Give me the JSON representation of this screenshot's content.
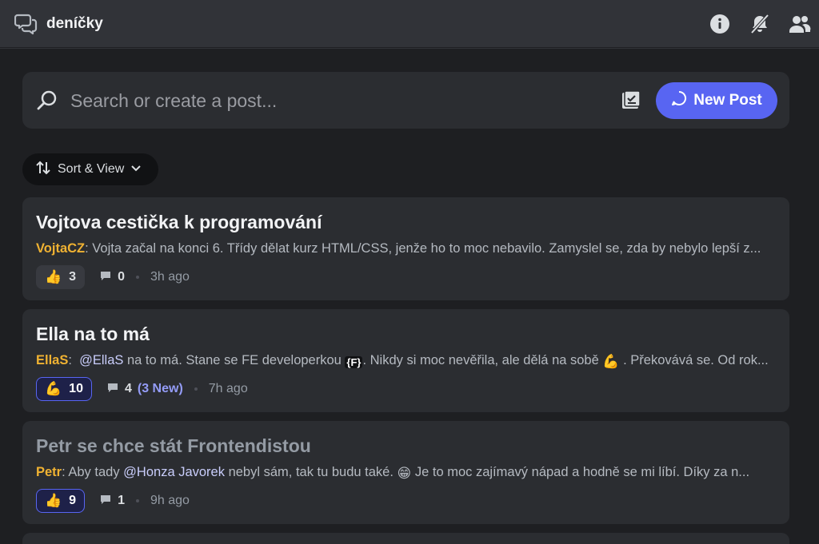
{
  "header": {
    "channel_name": "deníčky",
    "icons": [
      "forum-channel-icon",
      "info-icon",
      "notifications-muted-icon",
      "members-icon"
    ]
  },
  "search": {
    "placeholder": "Search or create a post...",
    "new_post_label": "New Post"
  },
  "sort": {
    "label": "Sort & View"
  },
  "posts": [
    {
      "title": "Vojtova cestička k programování",
      "author": "VojtaCZ",
      "preview": "Vojta začal na konci 6. Třídy dělat kurz HTML/CSS, jenže ho to moc nebavilo. Zamyslel se, zda by nebylo lepší z...",
      "reaction_emoji": "👍",
      "reaction_count": "3",
      "comment_count": "0",
      "new_comments": "",
      "time": "3h ago",
      "read": false
    },
    {
      "title": "Ella na to má",
      "author": "EllaS",
      "preview_parts": {
        "mention": "@EllaS",
        "text1": " na to má. Stane se FE developerkou ",
        "emoji1": "{F}",
        "text2": ". Nikdy si moc nevěřila, ale dělá na sobě ",
        "emoji2": "💪",
        "text3": " . Překovává se. Od rok..."
      },
      "reaction_emoji": "💪",
      "reaction_count": "10",
      "comment_count": "4",
      "new_comments": "(3 New)",
      "time": "7h ago",
      "read": false
    },
    {
      "title": "Petr se chce stát Frontendistou",
      "author": "Petr",
      "preview_parts": {
        "text1": "Aby tady ",
        "mention": "@Honza Javorek",
        "text2": " nebyl sám, tak tu budu také. ",
        "emoji1": "😁",
        "text3": " Je to moc zajímavý nápad a hodně se mi líbí. Díky za n..."
      },
      "reaction_emoji": "👍",
      "reaction_count": "9",
      "comment_count": "1",
      "new_comments": "",
      "time": "9h ago",
      "read": true
    }
  ],
  "colors": {
    "accent": "#5865f2",
    "author": "#f0b232",
    "background": "#1e1f22",
    "card": "#2b2d31"
  }
}
